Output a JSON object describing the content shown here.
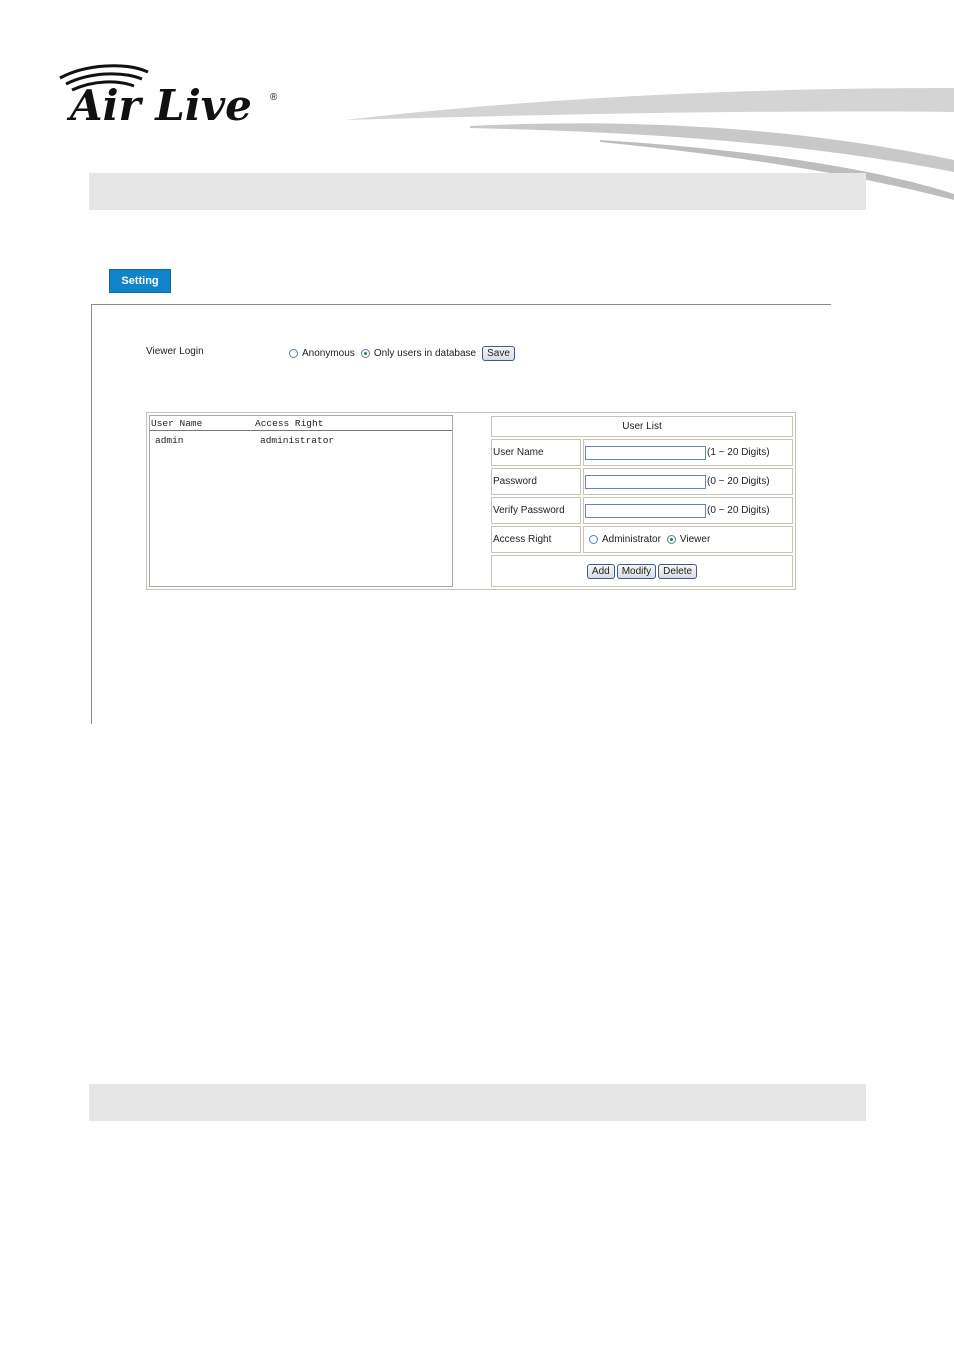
{
  "brand": {
    "logo_text": "Air Live",
    "registered_mark": "®"
  },
  "tab": {
    "label": "Setting"
  },
  "viewer_login": {
    "label": "Viewer Login",
    "options": [
      {
        "label": "Anonymous",
        "checked": false
      },
      {
        "label": "Only users in database",
        "checked": true
      }
    ],
    "save_label": "Save"
  },
  "user_listbox": {
    "headers": [
      "User Name",
      "Access Right"
    ],
    "rows": [
      {
        "user": "admin",
        "right": "administrator"
      }
    ]
  },
  "user_form": {
    "title": "User List",
    "fields": [
      {
        "label": "User Name",
        "value": "",
        "hint": "(1 ~ 20 Digits)"
      },
      {
        "label": "Password",
        "value": "",
        "hint": "(0 ~ 20 Digits)"
      },
      {
        "label": "Verify Password",
        "value": "",
        "hint": "(0 ~ 20 Digits)"
      }
    ],
    "access_right": {
      "label": "Access Right",
      "options": [
        {
          "label": "Administrator",
          "checked": false
        },
        {
          "label": "Viewer",
          "checked": true
        }
      ]
    },
    "buttons": {
      "add": "Add",
      "modify": "Modify",
      "delete": "Delete"
    }
  }
}
